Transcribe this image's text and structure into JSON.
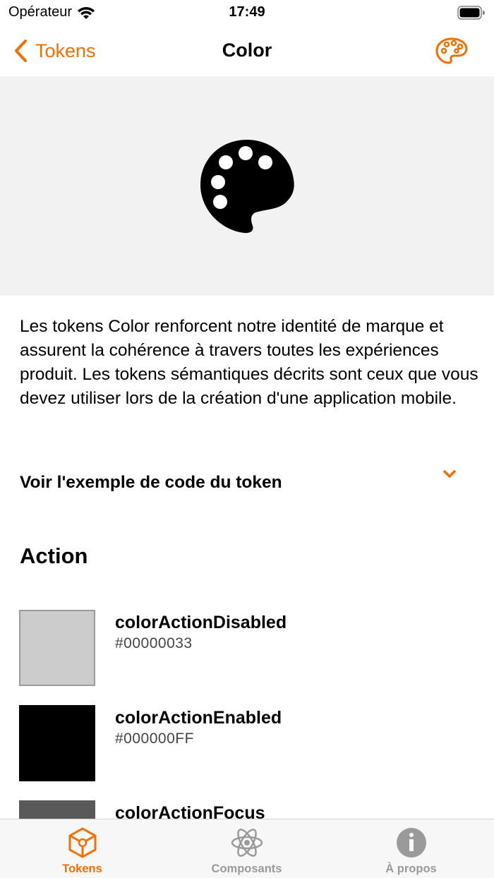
{
  "status_bar": {
    "carrier": "Opérateur",
    "time": "17:49"
  },
  "nav": {
    "back_label": "Tokens",
    "title": "Color"
  },
  "description": "Les tokens Color renforcent notre identité de marque et assurent la cohérence à travers toutes les expériences produit. Les tokens sémantiques décrits sont ceux que vous devez utiliser lors de la création d'une application mobile.",
  "accordion": {
    "label": "Voir l'exemple de code du token"
  },
  "section": {
    "title": "Action"
  },
  "tokens": [
    {
      "name": "colorActionDisabled",
      "value": "#00000033",
      "swatch": "#cccccc"
    },
    {
      "name": "colorActionEnabled",
      "value": "#000000FF",
      "swatch": "#000000"
    },
    {
      "name": "colorActionFocus",
      "value": "",
      "swatch": "#595959"
    }
  ],
  "tab_bar": {
    "tabs": [
      {
        "label": "Tokens",
        "icon": "cube-icon",
        "active": true
      },
      {
        "label": "Composants",
        "icon": "atom-icon",
        "active": false
      },
      {
        "label": "À propos",
        "icon": "info-icon",
        "active": false
      }
    ]
  },
  "colors": {
    "accent": "#f16e00",
    "hero_background": "#f2f2f2",
    "inactive_tab": "#9a9a9a"
  }
}
